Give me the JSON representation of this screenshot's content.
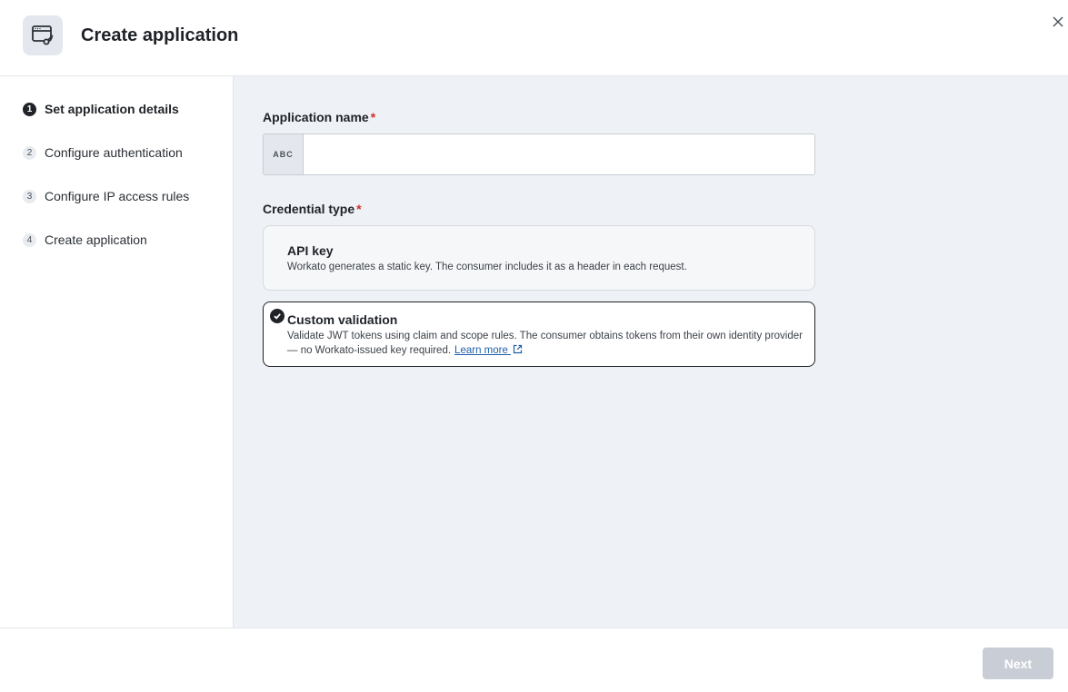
{
  "header": {
    "title": "Create application",
    "app_icon": "api-client-key-icon",
    "close_icon": "close-icon"
  },
  "sidebar": {
    "steps": [
      {
        "number": "1",
        "label": "Set application details",
        "active": true
      },
      {
        "number": "2",
        "label": "Configure authentication",
        "active": false
      },
      {
        "number": "3",
        "label": "Configure IP access rules",
        "active": false
      },
      {
        "number": "4",
        "label": "Create application",
        "active": false
      }
    ]
  },
  "form": {
    "app_name": {
      "label": "Application name",
      "required_marker": "*",
      "prefix": "ABC",
      "value": "",
      "placeholder": ""
    },
    "credential_type": {
      "label": "Credential type",
      "required_marker": "*",
      "options": [
        {
          "title": "API key",
          "description": "Workato generates a static key. The consumer includes it as a header in each request.",
          "selected": false
        },
        {
          "title": "Custom validation",
          "description": "Validate JWT tokens using claim and scope rules. The consumer obtains tokens from their own identity provider — no Workato-issued key required.",
          "link_text": "Learn more",
          "selected": true
        }
      ]
    }
  },
  "footer": {
    "next_label": "Next",
    "next_enabled": false
  },
  "colors": {
    "accent_dark": "#1f2328",
    "required": "#d0312d",
    "link": "#1f5fa8",
    "disabled_button": "#c9ced6",
    "main_bg": "#eef1f5"
  }
}
